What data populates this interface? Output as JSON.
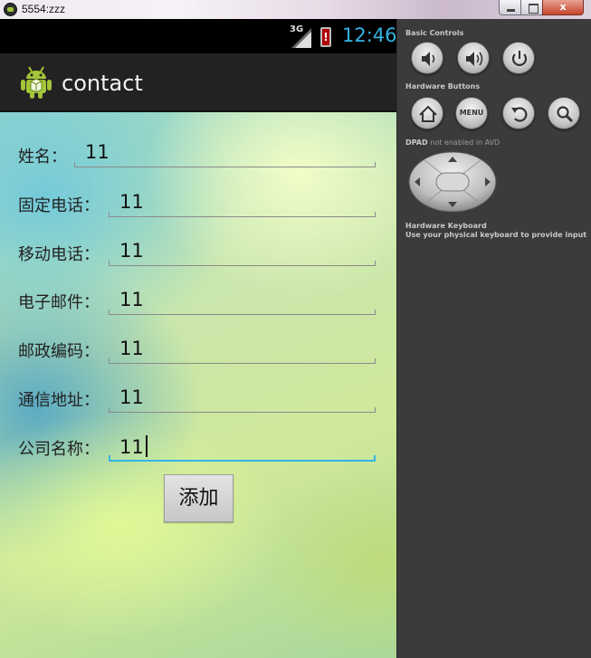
{
  "window": {
    "title": "5554:zzz",
    "close_glyph": "x"
  },
  "statusbar": {
    "network": "3G",
    "battery_alert": "!",
    "time": "12:46"
  },
  "actionbar": {
    "app_icon": "android-icon",
    "title": "contact"
  },
  "form": {
    "rows": [
      {
        "label": "姓名：",
        "value": "11"
      },
      {
        "label": "固定电话：",
        "value": "11"
      },
      {
        "label": "移动电话：",
        "value": "11"
      },
      {
        "label": "电子邮件：",
        "value": "11"
      },
      {
        "label": "邮政编码：",
        "value": "11"
      },
      {
        "label": "通信地址：",
        "value": "11"
      },
      {
        "label": "公司名称：",
        "value": "11"
      }
    ],
    "focused_row": "公司名称",
    "submit_label": "添加"
  },
  "panel": {
    "basic_controls_title": "Basic Controls",
    "basic_controls": [
      "volume-down-icon",
      "volume-up-icon",
      "power-icon"
    ],
    "hardware_buttons_title": "Hardware Buttons",
    "hardware_buttons": [
      "home-icon",
      "menu-button",
      "back-icon",
      "search-icon"
    ],
    "menu_label": "MENU",
    "dpad_title": "DPAD",
    "dpad_note": "not enabled in AVD",
    "keyboard_title": "Hardware Keyboard",
    "keyboard_note": "Use your physical keyboard to provide input"
  },
  "colors": {
    "accent": "#33b5e5",
    "actionbar": "#222222",
    "panel": "#3b3b3b"
  }
}
